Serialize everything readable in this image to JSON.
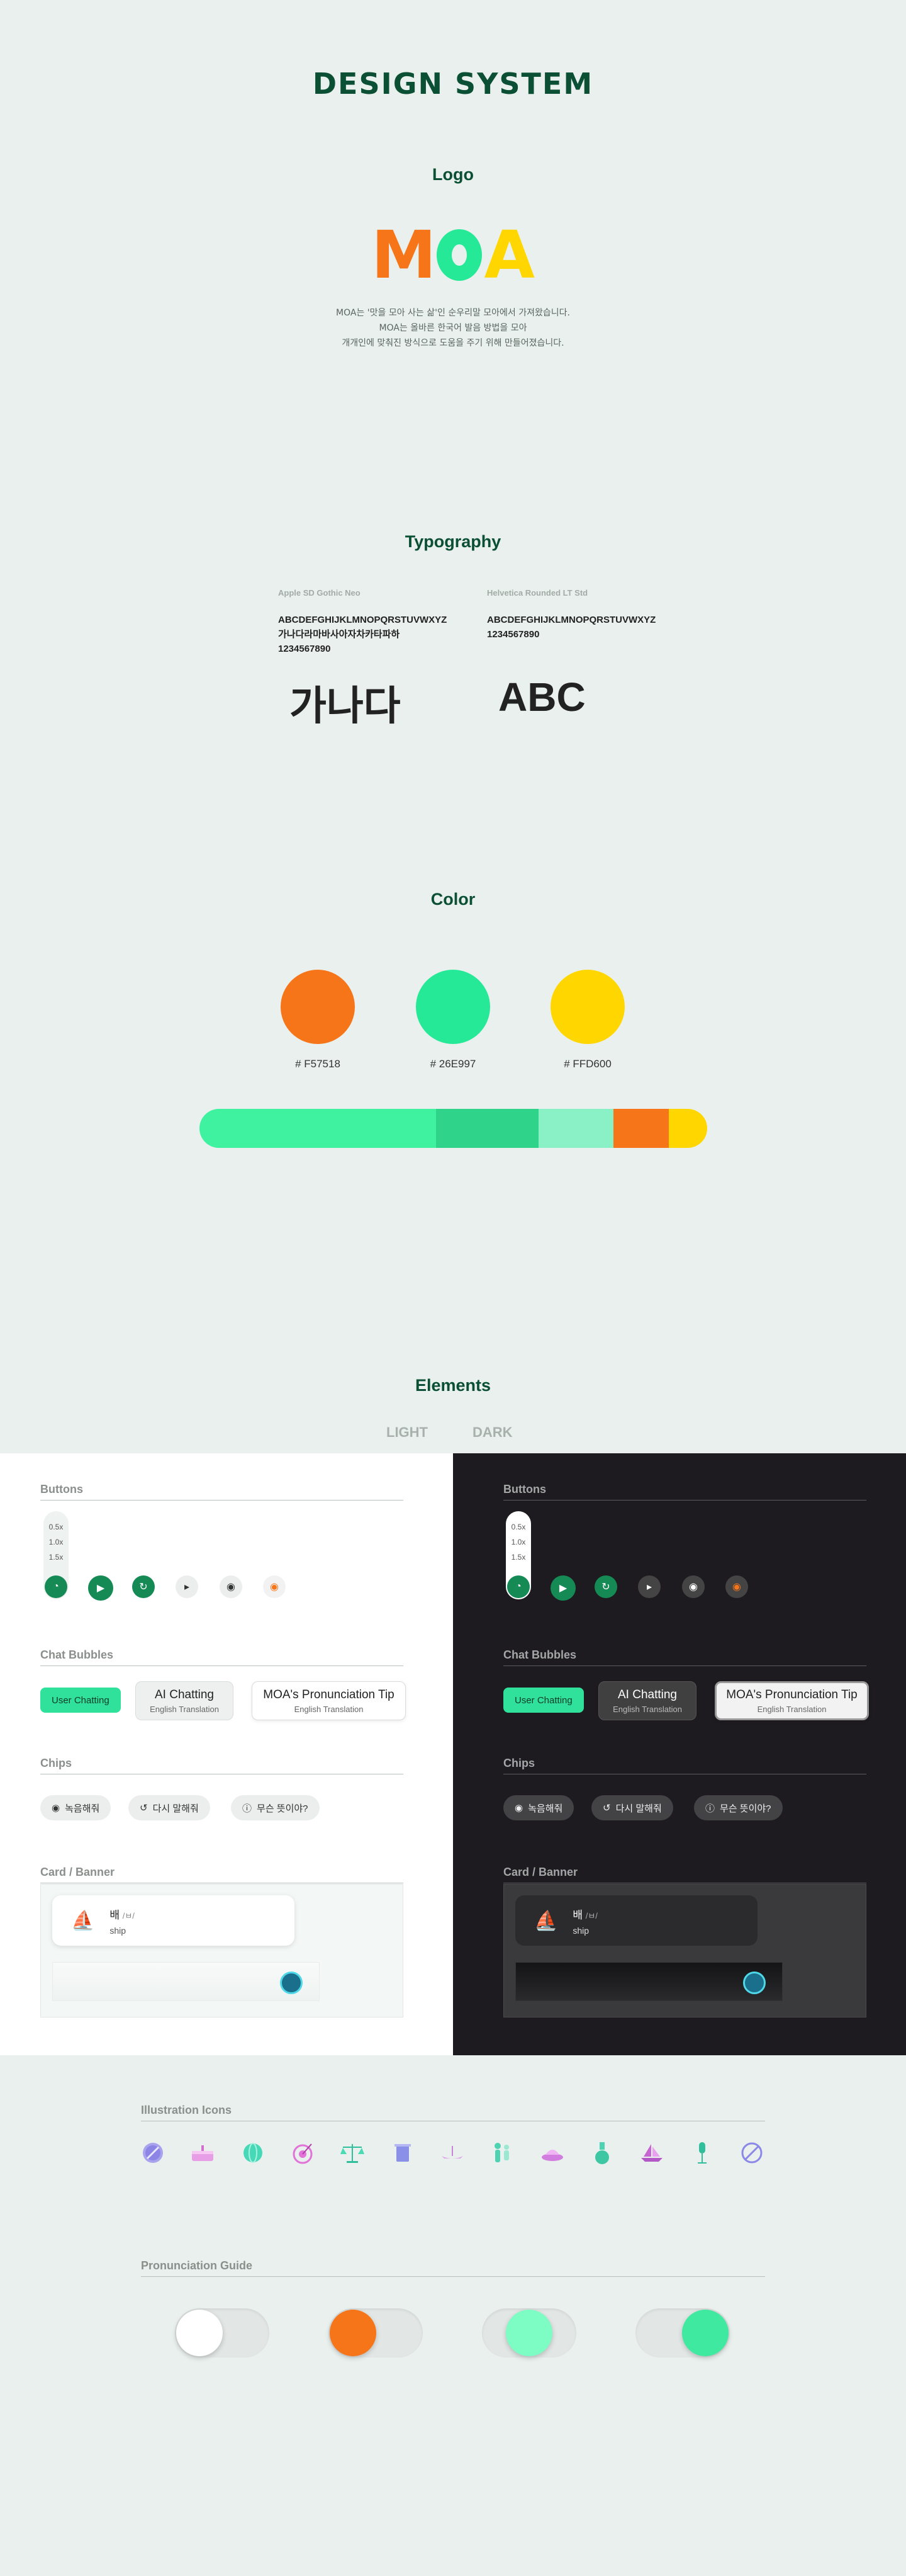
{
  "title": "DESIGN SYSTEM",
  "logo": {
    "section_title": "Logo",
    "letters": [
      "M",
      "O",
      "A"
    ],
    "description": [
      "MOA는 '맛을 모아 사는 삶'인 순우리말 모아에서 가져왔습니다.",
      "MOA는 올바른 한국어 발음 방법을 모아",
      "개개인에 맞춰진 방식으로 도움을 주기 위해 만들어졌습니다."
    ]
  },
  "typography": {
    "section_title": "Typography",
    "fonts": [
      {
        "name": "Apple SD Gothic Neo",
        "sample": [
          "ABCDEFGHIJKLMNOPQRSTUVWXYZ",
          "가나다라마바사아자차카타파하",
          "1234567890"
        ],
        "big": "가나다"
      },
      {
        "name": "Helvetica Rounded LT Std",
        "sample": [
          "ABCDEFGHIJKLMNOPQRSTUVWXYZ",
          "1234567890"
        ],
        "big": "ABC"
      }
    ]
  },
  "color": {
    "section_title": "Color",
    "swatches": [
      {
        "hex": "#F57518",
        "label": "# F57518"
      },
      {
        "hex": "#26E997",
        "label": "# 26E997"
      },
      {
        "hex": "#FFD600",
        "label": "# FFD600"
      }
    ],
    "bar_colors": [
      "#3ef2a0",
      "#2fd38a",
      "#8af1c6",
      "#f57518",
      "#ffd600"
    ]
  },
  "elements": {
    "section_title": "Elements",
    "tabs": [
      "LIGHT",
      "DARK"
    ],
    "buttons_title": "Buttons",
    "speeds": [
      "0.5x",
      "1.0x",
      "1.5x"
    ],
    "chat_title": "Chat Bubbles",
    "user_chat": "User Chatting",
    "ai_chat": {
      "main": "AI Chatting",
      "sub": "English Translation"
    },
    "tip_chat": {
      "main": "MOA's Pronunciation Tip",
      "sub": "English Translation"
    },
    "chips_title": "Chips",
    "chips": [
      "녹음해줘",
      "다시 말해줘",
      "무슨 뜻이야?"
    ],
    "card_title": "Card / Banner",
    "card": {
      "word": "배",
      "ipa": "/ㅂ/",
      "english": "ship"
    }
  },
  "illustration": {
    "section_title": "Illustration Icons",
    "icons": [
      "plate-icon",
      "cake-icon",
      "globe-icon",
      "target-icon",
      "scale-icon",
      "trashcan-icon",
      "boat-icon",
      "people-icon",
      "dish-icon",
      "flask-icon",
      "sailboat-icon",
      "microphone-icon",
      "forbidden-icon"
    ]
  },
  "pronunciation": {
    "section_title": "Pronunciation Guide",
    "toggle_colors": [
      "#ffffff",
      "#f57518",
      "#7dfcc4",
      "#3fe9a0"
    ]
  }
}
